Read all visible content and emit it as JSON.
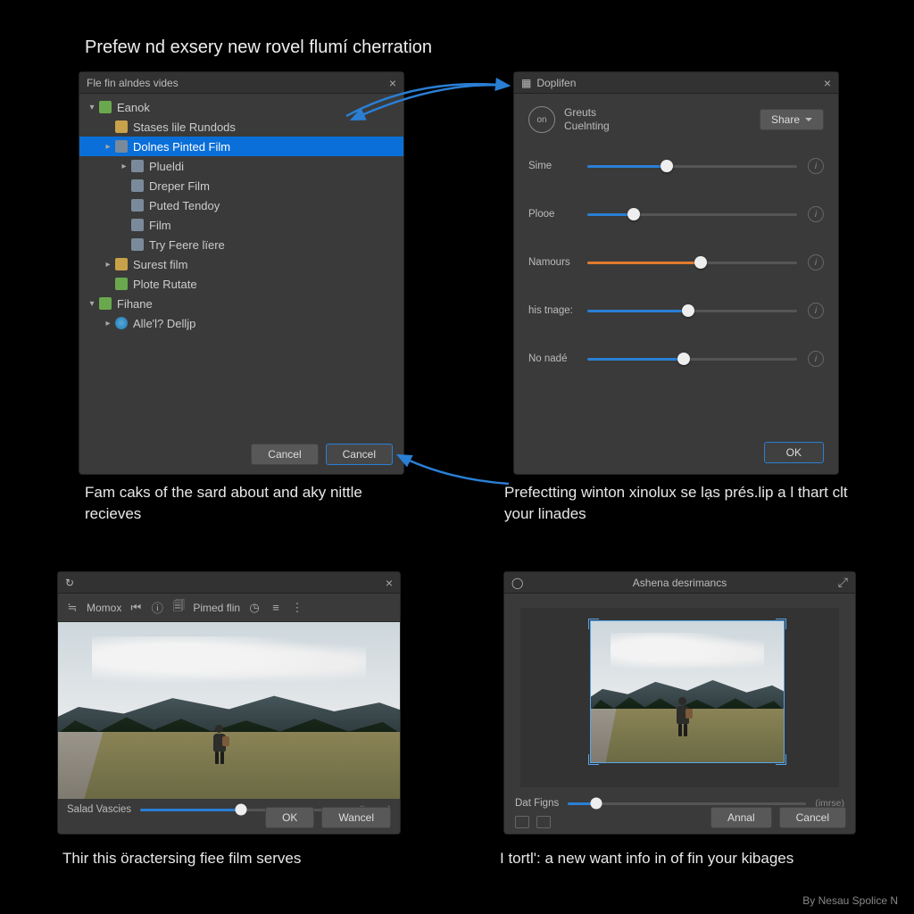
{
  "heading": "Prefew nd exsery new rovel flumí cherration",
  "panel1": {
    "title": "Fle fin alndes vides",
    "tree": [
      {
        "pad": 0,
        "disc": "▾",
        "ic": "ic-folder-green",
        "label": "Eanok"
      },
      {
        "pad": 1,
        "disc": "",
        "ic": "ic-folder-yellow",
        "label": "Stases lile Rundods"
      },
      {
        "pad": 1,
        "disc": "▸",
        "ic": "ic-file",
        "label": "Dolnes Pinted Film",
        "sel": true
      },
      {
        "pad": 2,
        "disc": "▸",
        "ic": "ic-file",
        "label": "Plueldi"
      },
      {
        "pad": 2,
        "disc": "",
        "ic": "ic-file",
        "label": "Dreper Film"
      },
      {
        "pad": 2,
        "disc": "",
        "ic": "ic-file",
        "label": "Puted Tendoy"
      },
      {
        "pad": 2,
        "disc": "",
        "ic": "ic-file",
        "label": "Film"
      },
      {
        "pad": 2,
        "disc": "",
        "ic": "ic-file",
        "label": "Try Feere lïere"
      },
      {
        "pad": 1,
        "disc": "▸",
        "ic": "ic-folder-yellow",
        "label": "Surest film"
      },
      {
        "pad": 1,
        "disc": "",
        "ic": "ic-folder-green",
        "label": "Plote Rutate"
      },
      {
        "pad": 0,
        "disc": "▾",
        "ic": "ic-folder-green",
        "label": "Fihane"
      },
      {
        "pad": 1,
        "disc": "▸",
        "ic": "ic-special",
        "label": "Alle'l? Delljp"
      }
    ],
    "cancel1": "Cancel",
    "cancel2": "Cancel"
  },
  "caption1": "Fam caks of the sard about and aky nittle recieves",
  "panel2": {
    "title": "Doplifen",
    "sub1": "Greuts",
    "sub2": "Cuelnting",
    "share": "Share",
    "sliders": [
      {
        "label": "Sime",
        "pct": 38,
        "orange": false
      },
      {
        "label": "Plooe",
        "pct": 22,
        "orange": false
      },
      {
        "label": "Namours",
        "pct": 54,
        "orange": true
      },
      {
        "label": "his tnage:",
        "pct": 48,
        "orange": false
      },
      {
        "label": "No nadé",
        "pct": 46,
        "orange": false
      }
    ],
    "ok": "OK"
  },
  "caption2": "Prefectting winton xinolux se lạs prés.lip a l thart clt your linades",
  "panel3": {
    "toolbar_label": "Momox",
    "toolbar_label2": "Pimed flin",
    "slider_label": "Salad Vascies",
    "slider_pct": 48,
    "hint": "(Inmes)",
    "ok": "OK",
    "cancel": "Wancel"
  },
  "caption3": "Thir this öractersing fiee film serves",
  "panel4": {
    "title": "Ashena desrimancs",
    "slider_label": "Dat Figns",
    "slider_pct": 12,
    "hint": "(imrse)",
    "btn1": "Annal",
    "btn2": "Cancel"
  },
  "caption4": "I tortl': a new want info in of fin your kibages",
  "byline": "By Nesau Spolice N"
}
